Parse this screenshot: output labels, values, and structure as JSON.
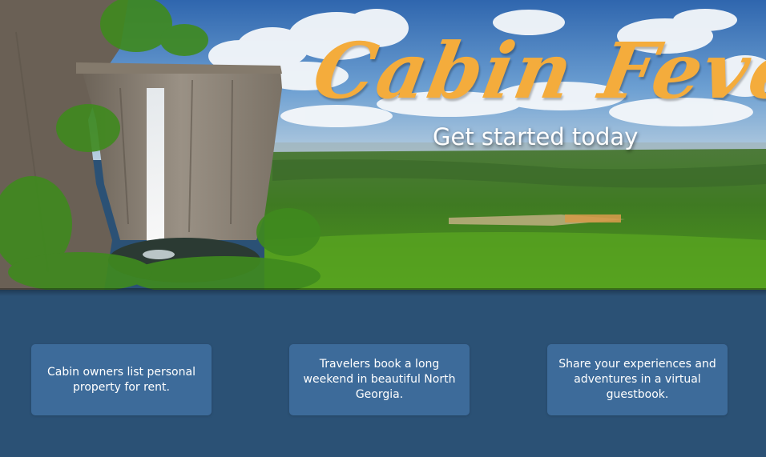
{
  "hero": {
    "title": "Cabin Fever",
    "tagline": "Get started today",
    "image": "landscape with waterfall cliff and green valley"
  },
  "features": [
    {
      "text": "Cabin owners list personal property for rent."
    },
    {
      "text": "Travelers book a long weekend in beautiful North Georgia."
    },
    {
      "text": "Share your experiences and adventures in a virtual guestbook."
    }
  ],
  "colors": {
    "title": "#f4ac3c",
    "tagline": "#ffffff",
    "background": "#2b5175",
    "card": "#3d6b9a",
    "card_text": "#ffffff"
  }
}
